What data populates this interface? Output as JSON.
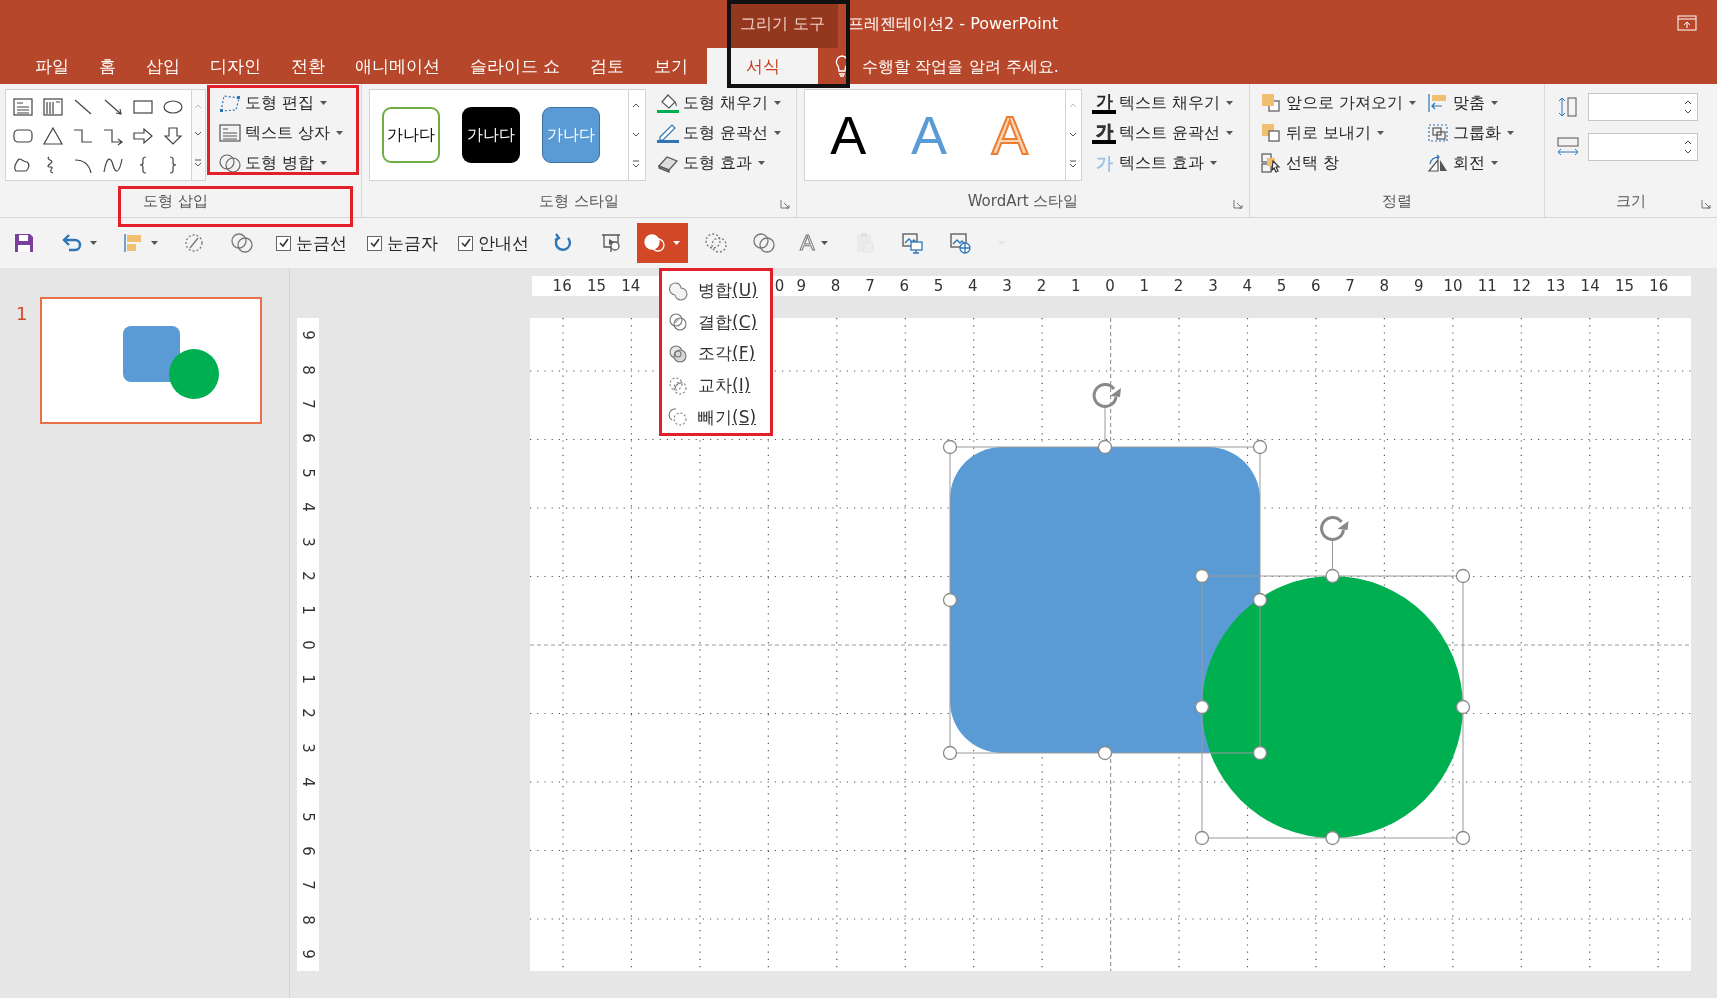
{
  "title_bar": {
    "context_group": {
      "label": "그리기 도구",
      "highlighted": true
    },
    "title": "프레젠테이션2 - PowerPoint"
  },
  "tabs": [
    {
      "label": "파일",
      "selected": false
    },
    {
      "label": "홈",
      "selected": false
    },
    {
      "label": "삽입",
      "selected": false
    },
    {
      "label": "디자인",
      "selected": false
    },
    {
      "label": "전환",
      "selected": false
    },
    {
      "label": "애니메이션",
      "selected": false
    },
    {
      "label": "슬라이드 쇼",
      "selected": false
    },
    {
      "label": "검토",
      "selected": false
    },
    {
      "label": "보기",
      "selected": false
    },
    {
      "label": "서식",
      "selected": true
    }
  ],
  "tell_me": {
    "placeholder": "수행할 작업을 알려 주세요."
  },
  "insert_shapes": {
    "label": "도형 삽입",
    "label_highlighted": true,
    "commands_highlighted": true,
    "commands": [
      {
        "label": "도형 편집",
        "kind": "edit",
        "menu": true
      },
      {
        "label": "텍스트 상자",
        "kind": "textbox",
        "menu": true
      },
      {
        "label": "도형 병합",
        "kind": "merge",
        "menu": true
      }
    ]
  },
  "shape_styles": {
    "label": "도형 스타일",
    "samples": [
      {
        "label": "가나다",
        "kind": "outline"
      },
      {
        "label": "가나다",
        "kind": "dark"
      },
      {
        "label": "가나다",
        "kind": "blue"
      }
    ],
    "commands": [
      {
        "label": "도형 채우기",
        "kind": "fill",
        "menu": true
      },
      {
        "label": "도형 윤곽선",
        "kind": "outline",
        "menu": true
      },
      {
        "label": "도형 효과",
        "kind": "effects",
        "menu": true
      }
    ]
  },
  "wordart_styles": {
    "label": "WordArt 스타일",
    "samples": [
      {
        "label": "A",
        "kind": "black"
      },
      {
        "label": "A",
        "kind": "blue"
      },
      {
        "label": "A",
        "kind": "orange"
      }
    ],
    "commands": [
      {
        "label": "텍스트 채우기",
        "kind": "text_fill",
        "glyph": "가",
        "menu": true
      },
      {
        "label": "텍스트 윤곽선",
        "kind": "text_outline",
        "glyph": "가",
        "menu": true
      },
      {
        "label": "텍스트 효과",
        "kind": "text_effects",
        "glyph": "가",
        "menu": true
      }
    ]
  },
  "arrange": {
    "label": "정렬",
    "commands": [
      {
        "label": "앞으로 가져오기",
        "kind": "forward",
        "menu": true
      },
      {
        "label": "뒤로 보내기",
        "kind": "backward",
        "menu": true
      },
      {
        "label": "선택 창",
        "kind": "pane",
        "menu": false
      },
      {
        "label": "맞춤",
        "kind": "align",
        "menu": true
      },
      {
        "label": "그룹화",
        "kind": "group",
        "menu": true
      },
      {
        "label": "회전",
        "kind": "rotate",
        "menu": true
      }
    ]
  },
  "size": {
    "label": "크기",
    "fields": [
      {
        "kind": "height"
      },
      {
        "kind": "width"
      }
    ]
  },
  "quick_access": [
    {
      "kind": "save",
      "menu": false,
      "disabled": false,
      "expanded": false
    },
    {
      "kind": "undo",
      "menu": true,
      "disabled": false,
      "expanded": false
    },
    {
      "kind": "arrange",
      "menu": true,
      "disabled": false,
      "expanded": false
    },
    {
      "kind": "edit_points",
      "menu": false,
      "disabled": false,
      "expanded": false
    },
    {
      "kind": "combine",
      "menu": false,
      "disabled": false,
      "expanded": false
    },
    {
      "kind": "checkbox",
      "label": "눈금선",
      "checked": true,
      "menu": false,
      "disabled": false,
      "expanded": false
    },
    {
      "kind": "checkbox",
      "label": "눈금자",
      "checked": true,
      "menu": false,
      "disabled": false,
      "expanded": false
    },
    {
      "kind": "checkbox",
      "label": "안내선",
      "checked": true,
      "menu": false,
      "disabled": false,
      "expanded": false
    },
    {
      "kind": "reset",
      "menu": false,
      "disabled": false,
      "expanded": false
    },
    {
      "kind": "slideshow",
      "menu": false,
      "disabled": false,
      "expanded": false
    },
    {
      "kind": "merge",
      "menu": true,
      "disabled": false,
      "expanded": true
    },
    {
      "kind": "fragment",
      "menu": false,
      "disabled": false,
      "expanded": false
    },
    {
      "kind": "intersect",
      "menu": false,
      "disabled": false,
      "expanded": false
    },
    {
      "kind": "text_effects",
      "glyph": "A",
      "menu": true,
      "disabled": false,
      "expanded": false
    },
    {
      "kind": "paste",
      "menu": false,
      "disabled": true,
      "expanded": false
    },
    {
      "kind": "screenshot",
      "menu": false,
      "disabled": false,
      "expanded": false
    },
    {
      "kind": "online_picture",
      "menu": false,
      "disabled": false,
      "expanded": false
    },
    {
      "kind": "customize",
      "menu": true,
      "disabled": true,
      "expanded": false
    }
  ],
  "merge_menu": {
    "highlighted": true,
    "items": [
      {
        "label": "병합",
        "key": "(U)",
        "kind": "union"
      },
      {
        "label": "결합",
        "key": "(C)",
        "kind": "combine"
      },
      {
        "label": "조각",
        "key": "(F)",
        "kind": "fragment"
      },
      {
        "label": "교차",
        "key": "(I)",
        "kind": "intersect"
      },
      {
        "label": "빼기",
        "key": "(S)",
        "kind": "subtract"
      }
    ]
  },
  "slides": [
    {
      "number": "1",
      "selected": true
    }
  ],
  "horizontal_ruler": {
    "left_labels": [
      "16",
      "15",
      "14"
    ],
    "right_labels": [
      "0",
      "9",
      "8",
      "7",
      "6",
      "5",
      "4",
      "3",
      "2",
      "1",
      "0",
      "1",
      "2",
      "3",
      "4",
      "5",
      "6",
      "7",
      "8",
      "9",
      "10",
      "11",
      "12",
      "13",
      "14",
      "15",
      "16"
    ]
  },
  "vertical_ruler": {
    "labels": [
      "9",
      "8",
      "7",
      "6",
      "5",
      "4",
      "3",
      "2",
      "1",
      "0",
      "1",
      "2",
      "3",
      "4",
      "5",
      "6",
      "7",
      "8",
      "9"
    ]
  },
  "slide": {
    "shapes": [
      {
        "kind": "rounded_rect",
        "color": "#5b9bd5",
        "selected": true
      },
      {
        "kind": "ellipse",
        "color": "#00b050",
        "selected": true
      }
    ]
  }
}
